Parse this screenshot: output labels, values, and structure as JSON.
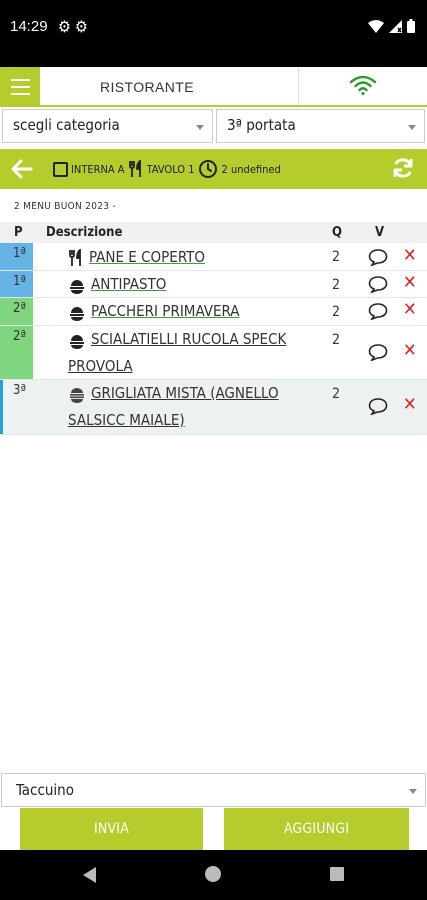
{
  "status": {
    "time": "14:29"
  },
  "header": {
    "title": "RISTORANTE"
  },
  "filters": {
    "category": "scegli categoria",
    "course": "3ª portata"
  },
  "toolbar": {
    "interna": "INTERNA A",
    "table": "TAVOLO 1",
    "time": "2 undefined"
  },
  "subtitle": "2 MENU BUON 2023 -",
  "table": {
    "headers": {
      "p": "P",
      "desc": "Descrizione",
      "q": "Q",
      "v": "V"
    },
    "rows": [
      {
        "p": "1ª",
        "icon": "cutlery-icon",
        "name": "PANE E COPERTO",
        "qty": "2",
        "color": "#66b3e6"
      },
      {
        "p": "1ª",
        "icon": "dish-icon",
        "name": "ANTIPASTO",
        "qty": "2",
        "color": "#66b3e6"
      },
      {
        "p": "2ª",
        "icon": "dish-icon",
        "name": "PACCHERI PRIMAVERA",
        "qty": "2",
        "color": "#7fd67f"
      },
      {
        "p": "2ª",
        "icon": "dish-icon",
        "name": "SCIALATIELLI RUCOLA SPECK PROVOLA",
        "qty": "2",
        "color": "#7fd67f"
      },
      {
        "p": "3ª",
        "icon": "grill-icon",
        "name": "GRIGLIATA MISTA (AGNELLO SALSICC MAIALE)",
        "qty": "2",
        "color": "#eef1f2"
      }
    ]
  },
  "notebook": "Taccuino",
  "buttons": {
    "send": "INVIA",
    "add": "AGGIUNGI"
  },
  "colors": {
    "accent": "#b5cc2c",
    "delete": "#e02020"
  }
}
